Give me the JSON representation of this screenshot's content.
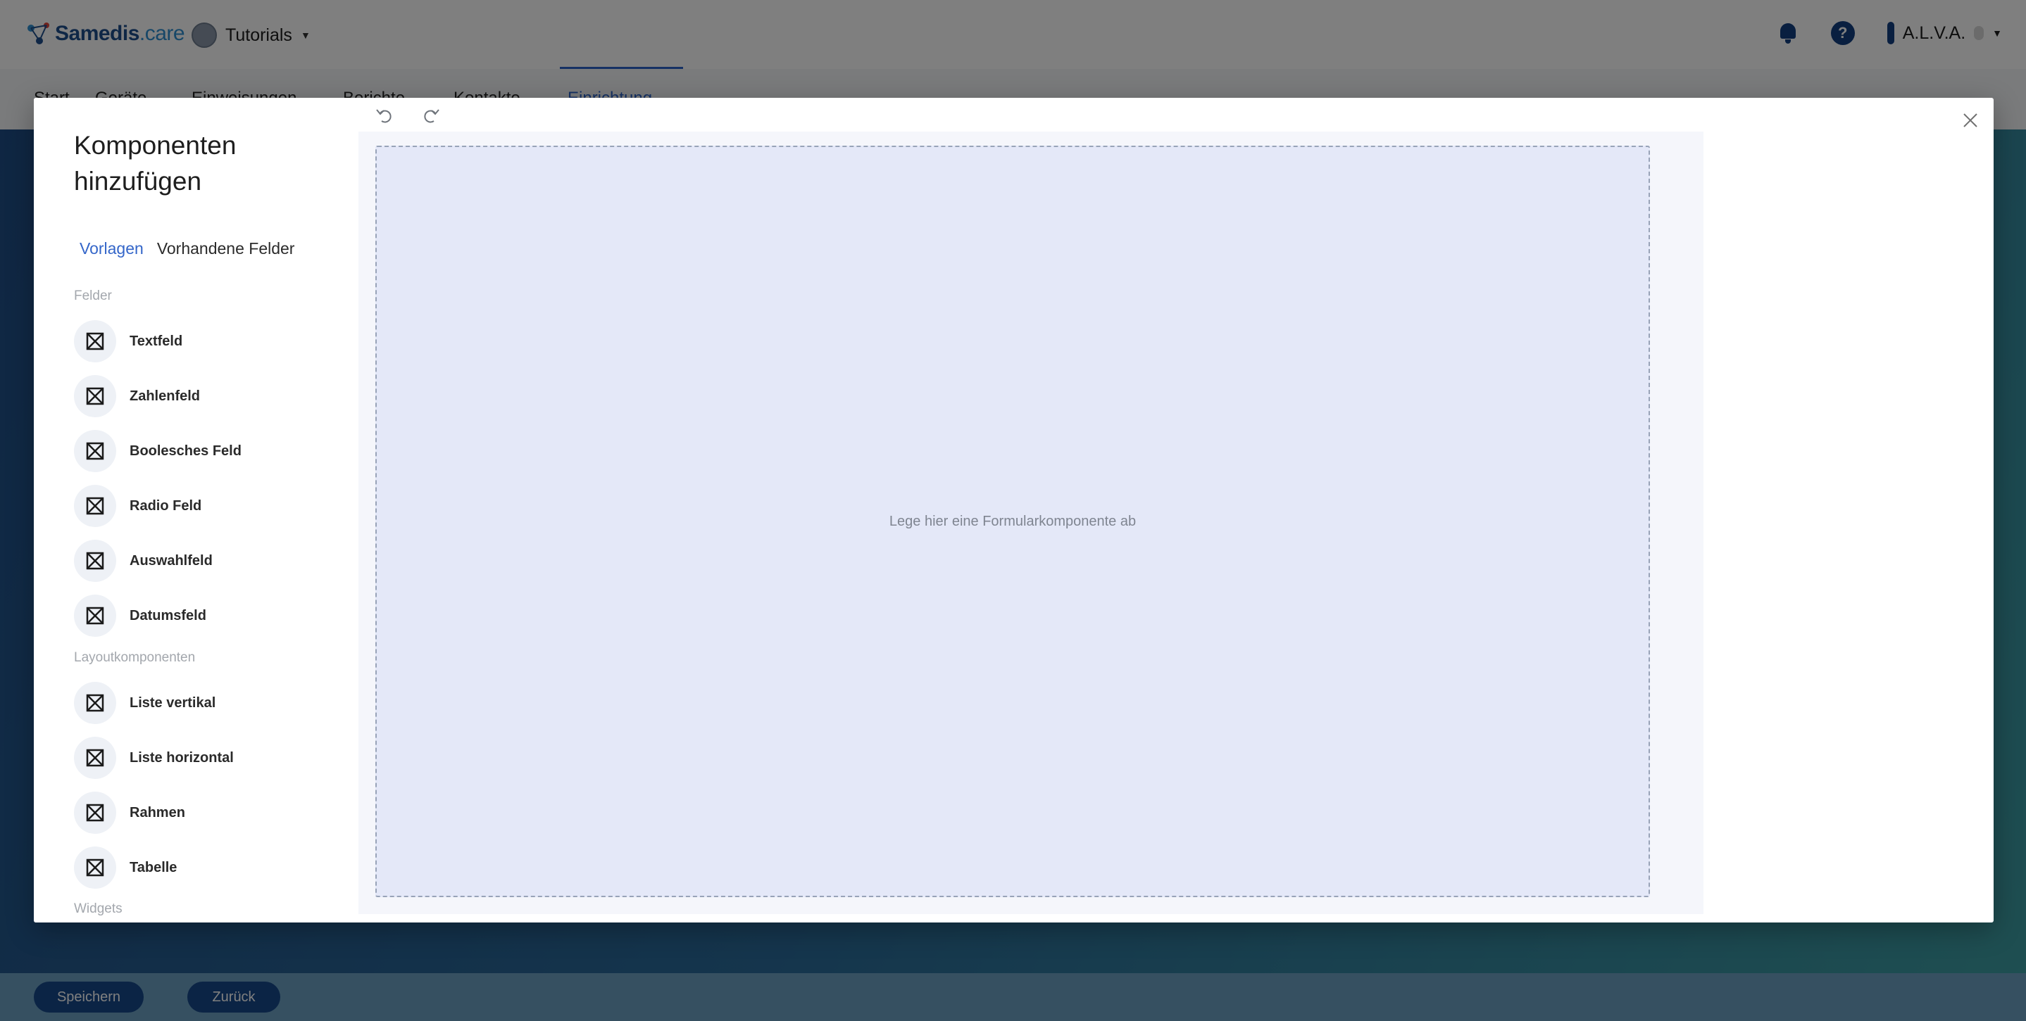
{
  "app": {
    "logo_main": "Samedis",
    "logo_suffix": ".care",
    "tenant": "Tutorials",
    "user": "A.L.V.A.",
    "help_glyph": "?",
    "nav_tabs": [
      "Start",
      "Geräte",
      "Einweisungen",
      "Berichte",
      "Kontakte",
      "Einrichtung"
    ],
    "active_tab": "Einrichtung",
    "footer": {
      "save_label": "Speichern",
      "back_label": "Zurück"
    }
  },
  "modal": {
    "title": "Komponenten hinzufügen",
    "tabs": [
      {
        "label": "Vorlagen",
        "active": true
      },
      {
        "label": "Vorhandene Felder",
        "active": false
      }
    ],
    "sections": [
      {
        "label": "Felder",
        "items": [
          "Textfeld",
          "Zahlenfeld",
          "Boolesches Feld",
          "Radio Feld",
          "Auswahlfeld",
          "Datumsfeld"
        ]
      },
      {
        "label": "Layoutkomponenten",
        "items": [
          "Liste vertikal",
          "Liste horizontal",
          "Rahmen",
          "Tabelle"
        ]
      },
      {
        "label": "Widgets",
        "items": []
      }
    ],
    "dropzone_hint": "Lege hier eine Formularkomponente ab"
  },
  "icons": {
    "undo": "undo-icon",
    "redo": "redo-icon",
    "close": "close-icon",
    "component": "placeholder-box-icon",
    "notifications": "bell-icon",
    "help": "help-icon"
  },
  "colors": {
    "accent": "#3466c9",
    "brand_dark": "#123f80",
    "dropzone_bg": "#e4e8f8"
  }
}
